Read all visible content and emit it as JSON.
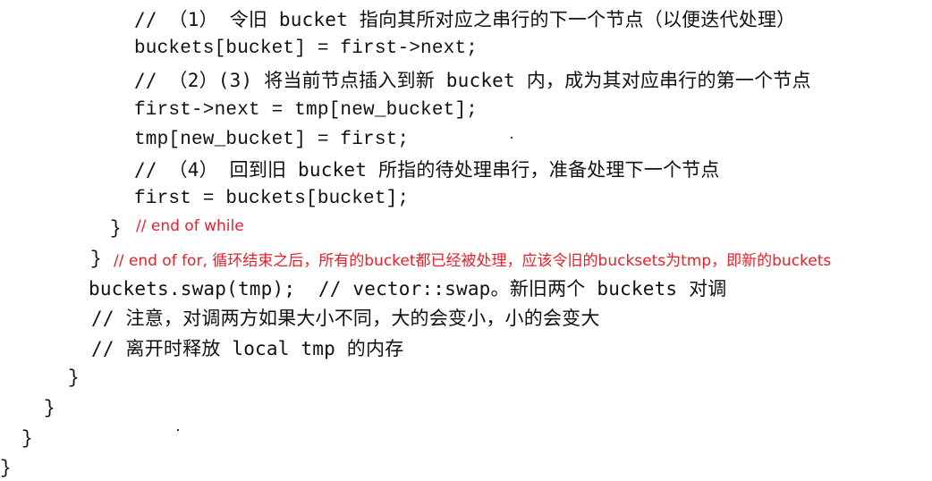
{
  "code_lines": [
    "// （1） 令旧 bucket 指向其所对应之串行的下一个节点（以便迭代处理）",
    "buckets[bucket] = first->next;",
    "// （2）(3) 将当前节点插入到新 bucket 内，成为其对应串行的第一个节点",
    "first->next = tmp[new_bucket];",
    "tmp[new_bucket] = first;",
    "// （4） 回到旧 bucket 所指的待处理串行，准备处理下一个节点",
    "first = buckets[bucket];",
    "}",
    "}",
    "buckets.swap(tmp);  // vector::swap。新旧两个 buckets 对调",
    "// 注意，对调两方如果大小不同，大的会变小，小的会变大",
    "// 离开时释放 local tmp 的内存",
    "}",
    "}",
    "}",
    "}"
  ],
  "annotations": {
    "end_of_while": "// end of while",
    "end_of_for": "// end of for, 循环结束之后，所有的bucket都已经被处理，应该令旧的bucksets为tmp，即新的buckets"
  },
  "colors": {
    "text": "#111111",
    "annotation": "#e8202a"
  }
}
